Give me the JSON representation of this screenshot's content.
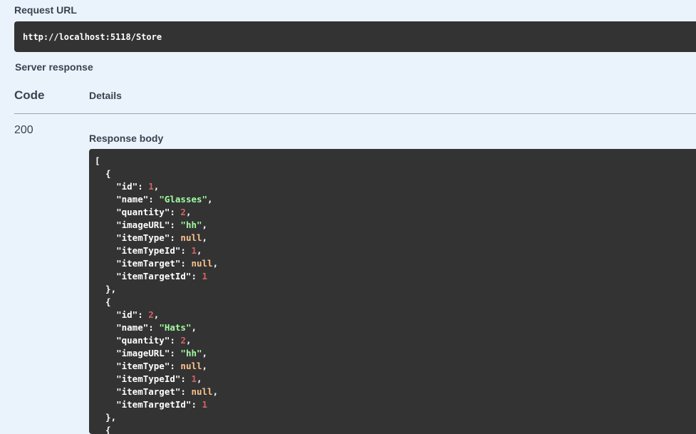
{
  "request_url": {
    "label": "Request URL",
    "value": "http://localhost:5118/Store"
  },
  "server_response": {
    "label": "Server response",
    "columns": {
      "code": "Code",
      "details": "Details"
    },
    "status_code": "200",
    "response_body_label": "Response body"
  },
  "response_body": {
    "items": [
      {
        "id": 1,
        "name": "\"Glasses\"",
        "quantity": 2,
        "imageURL": "\"hh\"",
        "itemType": "null",
        "itemTypeId": 1,
        "itemTarget": "null",
        "itemTargetId": 1
      },
      {
        "id": 2,
        "name": "\"Hats\"",
        "quantity": 2,
        "imageURL": "\"hh\"",
        "itemType": "null",
        "itemTypeId": 1,
        "itemTarget": "null",
        "itemTargetId": 1
      }
    ]
  },
  "colors": {
    "page_background": "#eaf3fc",
    "code_background": "#333333",
    "string": "#a2fca2",
    "number": "#d36363",
    "null": "#fcc28c"
  }
}
